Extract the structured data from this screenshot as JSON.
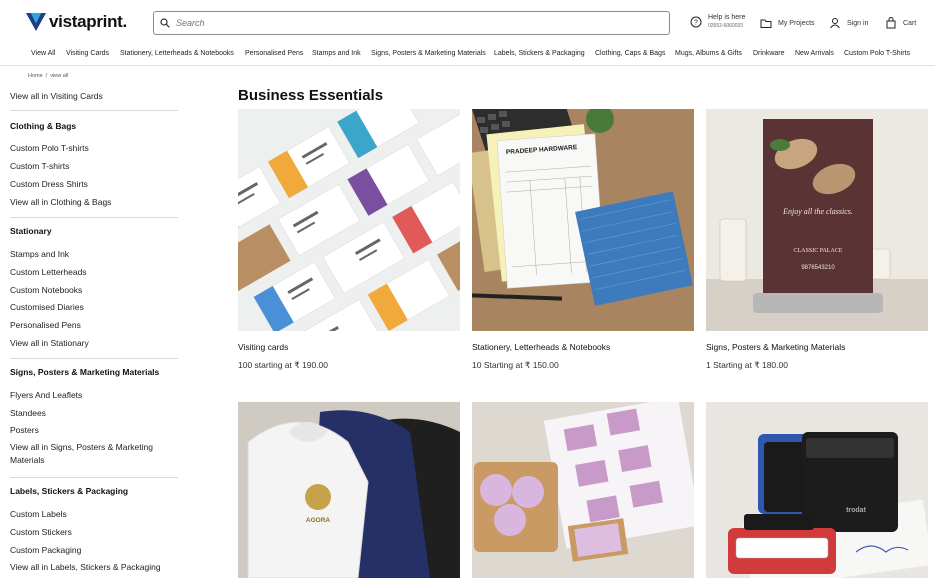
{
  "header": {
    "logo_text": "vistaprint.",
    "search_placeholder": "Search",
    "help_label": "Help is here",
    "help_phone": "02652-6060033",
    "projects_label": "My Projects",
    "signin_label": "Sign in",
    "cart_label": "Cart"
  },
  "nav": {
    "items": [
      "View All",
      "Visiting Cards",
      "Stationery, Letterheads & Notebooks",
      "Personalised Pens",
      "Stamps and Ink",
      "Signs, Posters & Marketing Materials",
      "Labels, Stickers & Packaging",
      "Clothing, Caps & Bags",
      "Mugs, Albums & Gifts",
      "Drinkware",
      "New Arrivals",
      "Custom Polo T-Shirts"
    ]
  },
  "breadcrumb": {
    "home": "Home",
    "sep": "/",
    "current": "view all"
  },
  "sidebar": {
    "visiting_all": "View all in Visiting Cards",
    "clothing": {
      "heading": "Clothing & Bags",
      "items": [
        "Custom Polo T-shirts",
        "Custom T-shirts",
        "Custom Dress Shirts",
        "View all in Clothing & Bags"
      ]
    },
    "stationary": {
      "heading": "Stationary",
      "items": [
        "Stamps and Ink",
        "Custom Letterheads",
        "Custom Notebooks",
        "Customised Diaries",
        "Personalised Pens",
        "View all in Stationary"
      ]
    },
    "signs": {
      "heading": "Signs, Posters & Marketing Materials",
      "items": [
        "Flyers And Leaflets",
        "Standees",
        "Posters",
        "View all in Signs, Posters & Marketing Materials"
      ]
    },
    "labels": {
      "heading": "Labels, Stickers & Packaging",
      "items": [
        "Custom Labels",
        "Custom Stickers",
        "Custom Packaging",
        "View all in Labels, Stickers & Packaging"
      ]
    }
  },
  "main": {
    "title": "Business Essentials",
    "cards": [
      {
        "title": "Visiting cards",
        "price": "100 starting at ₹ 190.00"
      },
      {
        "title": "Stationery, Letterheads & Notebooks",
        "price": "10 Starting at ₹ 150.00",
        "invoice_header": "PRADEEP HARDWARE"
      },
      {
        "title": "Signs, Posters & Marketing Materials",
        "price": "1 Starting at ₹ 180.00",
        "banner_tagline": "Enjoy all the classics.",
        "banner_name": "CLASSIC PALACE",
        "banner_phone": "9876543210"
      },
      {
        "title": "",
        "price": "",
        "hoodie_logo": "AGORA"
      },
      {
        "title": "",
        "price": ""
      },
      {
        "title": "",
        "price": "",
        "stamp_brand": "trodat"
      }
    ]
  },
  "colors": {
    "logo_blue": "#1b3e86",
    "logo_cyan": "#29a9e0",
    "text": "#1a1a1a"
  }
}
